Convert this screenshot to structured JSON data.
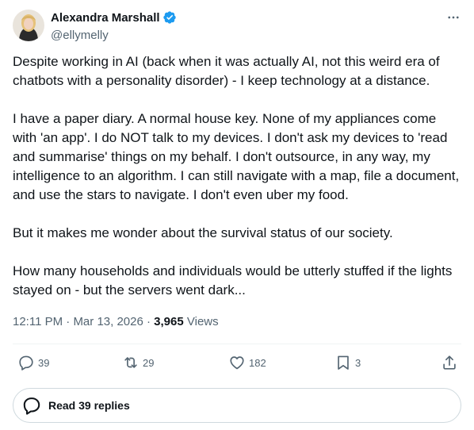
{
  "author": {
    "display_name": "Alexandra Marshall",
    "handle": "@ellymelly",
    "verified": true,
    "accent_color": "#1d9bf0"
  },
  "tweet": {
    "paragraphs": [
      "Despite working in AI (back when it was actually AI, not this weird era of chatbots with a personality disorder) - I keep technology at a distance.",
      "I have a paper diary. A normal house key. None of my appliances come with 'an app'. I do NOT talk to my devices. I don't ask my devices to 'read and summarise' things on my behalf. I don't outsource, in any way, my intelligence to an algorithm. I can still navigate with a map, file a document, and use the stars to navigate. I don't even uber my food.",
      "But it makes me wonder about the survival status of our society.",
      "How many households and individuals would be utterly stuffed if the lights stayed on - but the servers went dark..."
    ],
    "time": "12:11 PM",
    "date": "Mar 13, 2026",
    "views_count": "3,965",
    "views_label": "Views"
  },
  "actions": {
    "replies": "39",
    "reposts": "29",
    "likes": "182",
    "bookmarks": "3"
  },
  "read_replies": {
    "label": "Read 39 replies"
  },
  "icons": {
    "more": "more-dots-icon",
    "reply": "speech-bubble-icon",
    "repost": "repost-arrows-icon",
    "like": "heart-icon",
    "bookmark": "bookmark-icon",
    "share": "share-upload-icon",
    "verified": "verified-badge-icon"
  }
}
